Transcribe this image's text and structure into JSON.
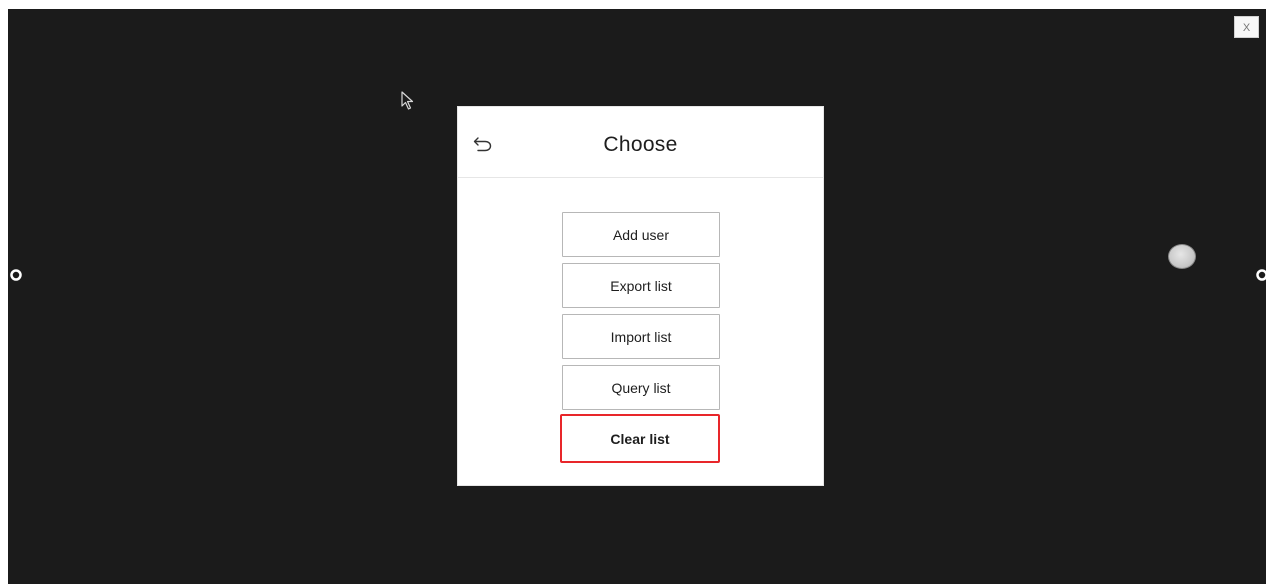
{
  "window": {
    "close_label": "X"
  },
  "dialog": {
    "title": "Choose",
    "back_icon": "undo-arrow-icon",
    "buttons": [
      {
        "label": "Add user"
      },
      {
        "label": "Export list"
      },
      {
        "label": "Import list"
      },
      {
        "label": "Query list"
      },
      {
        "label": "Clear list",
        "highlight_color": "#e8262a"
      }
    ]
  },
  "icons": {
    "cursor": "mouse-pointer-icon",
    "left_handle": "gear-icon",
    "right_handle": "gear-icon",
    "float_ball": "assistive-ball-icon"
  },
  "colors": {
    "background": "#1b1b1b",
    "dialog": "#ffffff",
    "highlight": "#e8262a"
  }
}
